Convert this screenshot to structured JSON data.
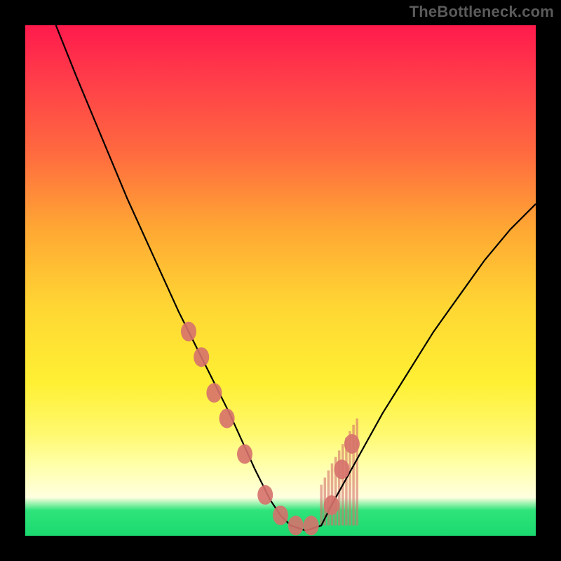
{
  "watermark": "TheBottleneck.com",
  "chart_data": {
    "type": "line",
    "title": "",
    "xlabel": "",
    "ylabel": "",
    "xlim": [
      0,
      100
    ],
    "ylim": [
      0,
      100
    ],
    "series": [
      {
        "name": "curve",
        "x": [
          6,
          10,
          15,
          20,
          25,
          30,
          35,
          40,
          45,
          48,
          50,
          52,
          55,
          58,
          60,
          65,
          70,
          75,
          80,
          85,
          90,
          95,
          100
        ],
        "y": [
          100,
          90,
          78,
          66,
          55,
          44,
          34,
          24,
          13,
          7,
          4,
          2,
          1,
          2,
          6,
          15,
          24,
          32,
          40,
          47,
          54,
          60,
          65
        ]
      }
    ],
    "markers": {
      "name": "highlight-points",
      "x": [
        32,
        34.5,
        37,
        39.5,
        43,
        47,
        50,
        53,
        56,
        60,
        62,
        64
      ],
      "y": [
        40,
        35,
        28,
        23,
        16,
        8,
        4,
        2,
        2,
        6,
        13,
        18
      ],
      "color": "#d6716b"
    },
    "hatch_band": {
      "x": [
        58,
        65
      ],
      "y_top": [
        28,
        28
      ],
      "y_bottom": [
        2,
        2
      ],
      "color": "#d6716b"
    }
  }
}
